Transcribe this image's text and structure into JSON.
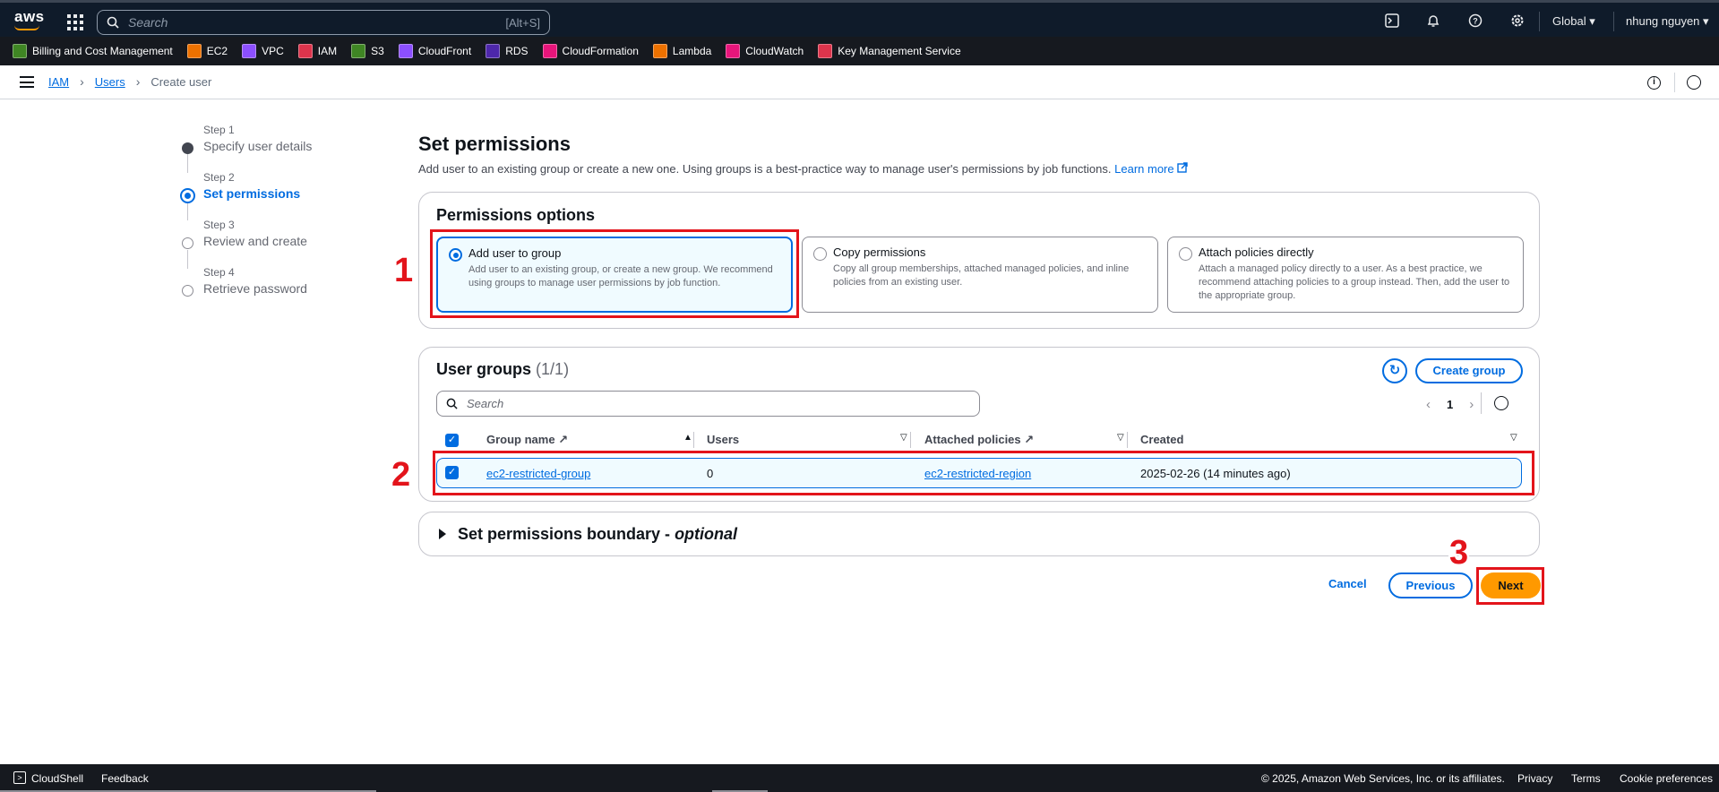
{
  "topnav": {
    "logo": "aws",
    "search_placeholder": "Search",
    "search_shortcut": "[Alt+S]",
    "region": "Global ▾",
    "user": "nhung nguyen ▾",
    "icons": [
      "cloudshell-icon",
      "bell-icon",
      "help-icon",
      "gear-icon"
    ]
  },
  "favorites": [
    {
      "label": "Billing and Cost Management",
      "color": "#3f8624"
    },
    {
      "label": "EC2",
      "color": "#ed7100"
    },
    {
      "label": "VPC",
      "color": "#8c4fff"
    },
    {
      "label": "IAM",
      "color": "#dd344c"
    },
    {
      "label": "S3",
      "color": "#3f8624"
    },
    {
      "label": "CloudFront",
      "color": "#8c4fff"
    },
    {
      "label": "RDS",
      "color": "#4d27aa"
    },
    {
      "label": "CloudFormation",
      "color": "#e7157b"
    },
    {
      "label": "Lambda",
      "color": "#ed7100"
    },
    {
      "label": "CloudWatch",
      "color": "#e7157b"
    },
    {
      "label": "Key Management Service",
      "color": "#dd344c"
    }
  ],
  "breadcrumb": {
    "items": [
      "IAM",
      "Users",
      "Create user"
    ]
  },
  "steps": [
    {
      "num": "Step 1",
      "title": "Specify user details",
      "state": "done"
    },
    {
      "num": "Step 2",
      "title": "Set permissions",
      "state": "active"
    },
    {
      "num": "Step 3",
      "title": "Review and create",
      "state": "pending"
    },
    {
      "num": "Step 4",
      "title": "Retrieve password",
      "state": "pending"
    }
  ],
  "page": {
    "title": "Set permissions",
    "description": "Add user to an existing group or create a new one. Using groups is a best-practice way to manage user's permissions by job functions.",
    "learn_more": "Learn more"
  },
  "permissions": {
    "title": "Permissions options",
    "options": [
      {
        "title": "Add user to group",
        "desc": "Add user to an existing group, or create a new group. We recommend using groups to manage user permissions by job function.",
        "selected": true
      },
      {
        "title": "Copy permissions",
        "desc": "Copy all group memberships, attached managed policies, and inline policies from an existing user.",
        "selected": false
      },
      {
        "title": "Attach policies directly",
        "desc": "Attach a managed policy directly to a user. As a best practice, we recommend attaching policies to a group instead. Then, add the user to the appropriate group.",
        "selected": false
      }
    ]
  },
  "groups": {
    "title": "User groups",
    "count": "(1/1)",
    "create_label": "Create group",
    "search_placeholder": "Search",
    "page": "1",
    "columns": [
      "Group name",
      "Users",
      "Attached policies",
      "Created"
    ],
    "rows": [
      {
        "name": "ec2-restricted-group",
        "users": "0",
        "policies": "ec2-restricted-region",
        "created": "2025-02-26 (14 minutes ago)",
        "checked": true
      }
    ]
  },
  "boundary": {
    "title": "Set permissions boundary - ",
    "optional": "optional"
  },
  "actions": {
    "cancel": "Cancel",
    "previous": "Previous",
    "next": "Next"
  },
  "annotations": [
    "1",
    "2",
    "3"
  ],
  "footer": {
    "cloudshell": "CloudShell",
    "feedback": "Feedback",
    "copyright": "© 2025, Amazon Web Services, Inc. or its affiliates.",
    "privacy": "Privacy",
    "terms": "Terms",
    "cookies": "Cookie preferences"
  },
  "colors": {
    "accent": "#006ce0",
    "primary_button": "#ff9900",
    "annotation": "#e3141b",
    "nav_bg": "#0f1b2a"
  }
}
